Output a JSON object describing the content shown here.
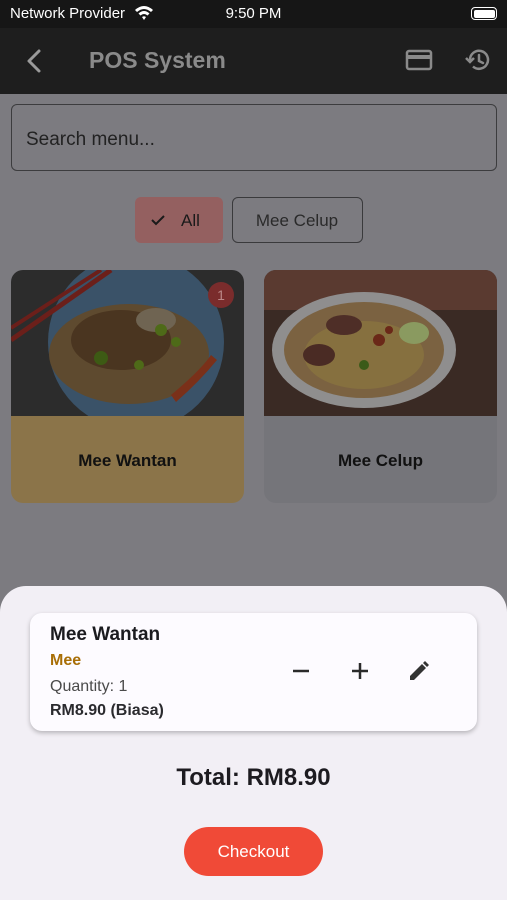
{
  "status_bar": {
    "carrier": "Network Provider",
    "time": "9:50 PM"
  },
  "app_bar": {
    "title": "POS System"
  },
  "search": {
    "placeholder": "Search menu..."
  },
  "filters": [
    {
      "label": "All",
      "selected": true
    },
    {
      "label": "Mee Celup",
      "selected": false
    }
  ],
  "menu": [
    {
      "name": "Mee Wantan",
      "badge": "1",
      "selected": true
    },
    {
      "name": "Mee Celup",
      "badge": "",
      "selected": false
    }
  ],
  "cart": {
    "items": [
      {
        "name": "Mee Wantan",
        "category": "Mee",
        "quantity": "Quantity: 1",
        "price": "RM8.90 (Biasa)"
      }
    ],
    "total": "Total: RM8.90",
    "checkout_label": "Checkout"
  },
  "colors": {
    "accent": "#f04a37",
    "category": "#a86e06",
    "sheet": "#f2eff5"
  }
}
